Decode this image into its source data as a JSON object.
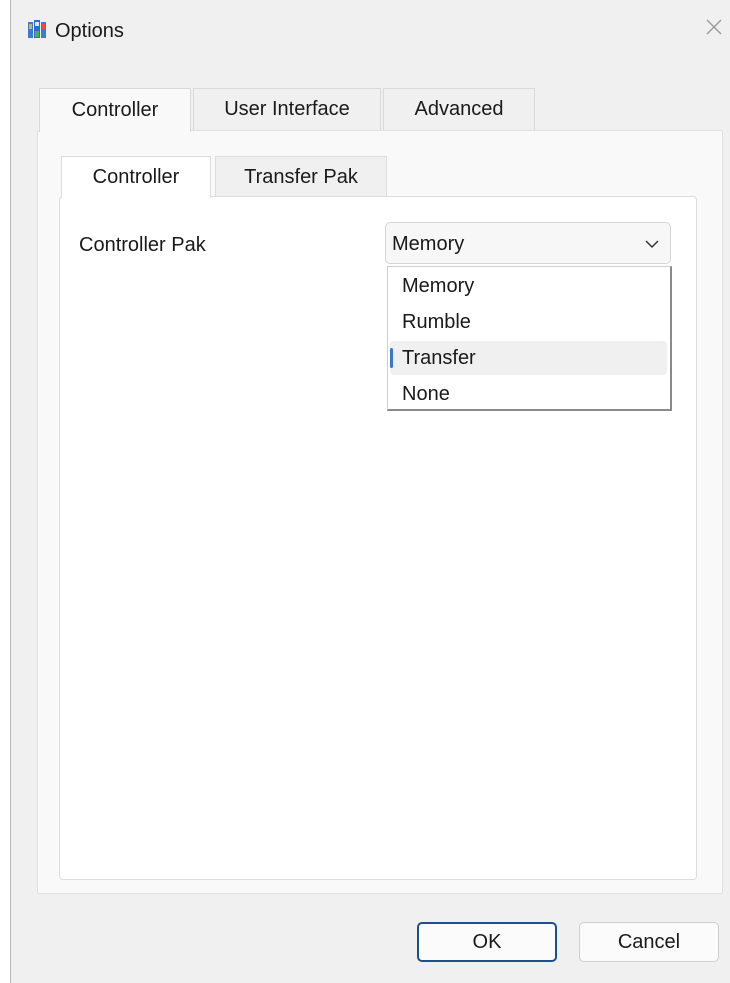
{
  "window": {
    "title": "Options"
  },
  "tabs": [
    {
      "label": "Controller",
      "active": true
    },
    {
      "label": "User Interface",
      "active": false
    },
    {
      "label": "Advanced",
      "active": false
    }
  ],
  "inner_tabs": [
    {
      "label": "Controller",
      "active": true
    },
    {
      "label": "Transfer Pak",
      "active": false
    }
  ],
  "controller_pak": {
    "label": "Controller Pak",
    "selected": "Memory",
    "options": [
      "Memory",
      "Rumble",
      "Transfer",
      "None"
    ],
    "highlighted": "Transfer"
  },
  "buttons": {
    "ok": "OK",
    "cancel": "Cancel"
  },
  "icons": {
    "app": "app-icon",
    "close": "close-icon",
    "dropdown": "chevron-down-icon"
  }
}
